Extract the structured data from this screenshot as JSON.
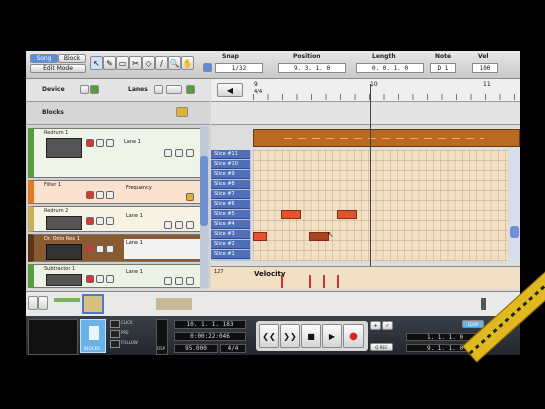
{
  "toolbar": {
    "song_label": "Song",
    "block_label": "Block",
    "edit_mode_label": "Edit Mode",
    "snap_label": "Snap",
    "snap_value": "1/32",
    "position_label": "Position",
    "position_value": "9. 3. 1. 0",
    "length_label": "Length",
    "length_value": "0. 0. 1. 0",
    "note_label": "Note",
    "note_value": "D 1",
    "vel_label": "Vel",
    "vel_value": "100"
  },
  "panel": {
    "device_label": "Device",
    "lanes_label": "Lanes",
    "blocks_label": "Blocks"
  },
  "ruler": {
    "marks": [
      "9",
      "10",
      "11"
    ],
    "signature": "4/4"
  },
  "tracks": [
    {
      "name": "Redrum 1",
      "lane": "Lane 1"
    },
    {
      "name": "Filter 1",
      "lane": "Frequency"
    },
    {
      "name": "Redrum 2",
      "lane": "Lane 1"
    },
    {
      "name": "Dr. Octo Rex 1",
      "lane": "Lane 1"
    },
    {
      "name": "Subtractor 1",
      "lane": "Lane 1"
    }
  ],
  "slices": [
    "Slice #11",
    "Slice #10",
    "Slice #9",
    "Slice #8",
    "Slice #7",
    "Slice #6",
    "Slice #5",
    "Slice #4",
    "Slice #3",
    "Slice #2",
    "Slice #1"
  ],
  "velocity": {
    "label": "Velocity",
    "value": "127"
  },
  "transport": {
    "bars_value": "10. 1. 1. 183",
    "time_value": "0:00:22:046",
    "tempo_value": "95.000",
    "signature_value": "4/4",
    "blocks_label": "BLOCKS",
    "click_label": "CLICK",
    "pre_label": "PRE",
    "follow_label": "FOLLOW",
    "loop_label": "LOOP",
    "qrec_label": "Q REC",
    "dsp_label": "DSP",
    "left_loc": "1. 1. 1. 0",
    "right_loc": "9. 1. 1. 0"
  },
  "colors": {
    "slice_blue": "#4f6fb8",
    "note_red": "#e0532e",
    "block_brown": "#b86a20",
    "grid_bg": "#f2e0c4"
  }
}
